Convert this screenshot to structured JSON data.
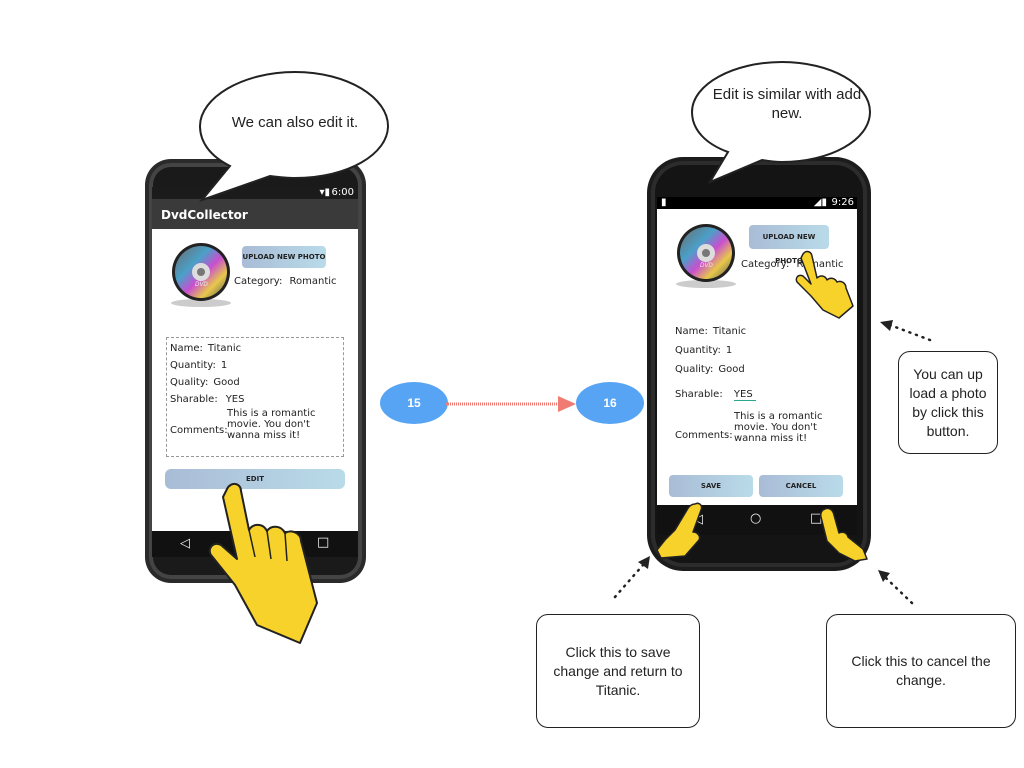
{
  "left_phone": {
    "bubble_text": "We can also edit it.",
    "status_time": "6:00",
    "app_title": "DvdCollector",
    "upload_button": "UPLOAD NEW PHOTO",
    "category_label": "Category:",
    "category_value": "Romantic",
    "name_label": "Name:",
    "name_value": "Titanic",
    "quantity_label": "Quantity:",
    "quantity_value": "1",
    "quality_label": "Quality:",
    "quality_value": "Good",
    "sharable_label": "Sharable:",
    "sharable_value": "YES",
    "comments_label": "Comments:",
    "comments_value": "This is a romantic movie. You don't wanna miss it!",
    "edit_button": "EDIT",
    "dvd_label": "DVD"
  },
  "right_phone": {
    "bubble_text": "Edit is similar with add new.",
    "status_time": "9:26",
    "upload_button": "UPLOAD NEW PHOTO",
    "category_label": "Category:",
    "category_value": "Romantic",
    "name_label": "Name:",
    "name_value": "Titanic",
    "quantity_label": "Quantity:",
    "quantity_value": "1",
    "quality_label": "Quality:",
    "quality_value": "Good",
    "sharable_label": "Sharable:",
    "sharable_value": "YES",
    "comments_label": "Comments:",
    "comments_value": "This is a romantic movie. You don't wanna miss it!",
    "save_button": "SAVE",
    "cancel_button": "CANCEL",
    "dvd_label": "DVD"
  },
  "flow": {
    "from_step": "15",
    "to_step": "16"
  },
  "notes": {
    "upload_note": "You can up load a photo by click this button.",
    "save_note": "Click this to save change and return to Titanic.",
    "cancel_note": "Click this to cancel the change."
  },
  "nav_glyphs": {
    "back": "◁",
    "home": "○",
    "recents": "□"
  },
  "colors": {
    "step_circle": "#57a4f4",
    "arrow": "#f07b73",
    "hand": "#f7d22a",
    "button_gradient_start": "#a9bcd6",
    "button_gradient_end": "#b9dbe9"
  }
}
